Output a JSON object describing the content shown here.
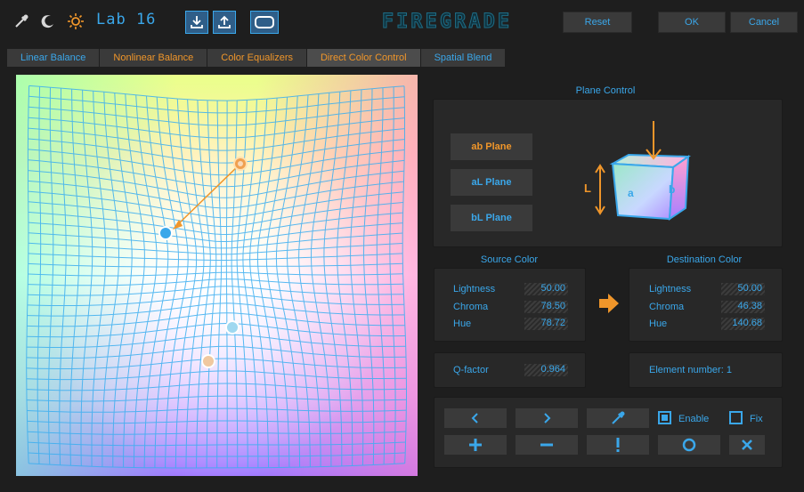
{
  "toolbar": {
    "icons": [
      "eyedropper-icon",
      "moon-icon",
      "sun-icon",
      "download-icon",
      "upload-icon",
      "display-frame-icon"
    ],
    "mode": "Lab 16",
    "brand": "FIREGRADE",
    "reset_label": "Reset",
    "ok_label": "OK",
    "cancel_label": "Cancel"
  },
  "tabs": [
    {
      "label": "Linear Balance",
      "color": "#3aa7ea",
      "active": false
    },
    {
      "label": "Nonlinear Balance",
      "color": "#f0962a",
      "active": false
    },
    {
      "label": "Color Equalizers",
      "color": "#f0962a",
      "active": false
    },
    {
      "label": "Direct Color Control",
      "color": "#f0962a",
      "active": true
    },
    {
      "label": "Spatial Blend",
      "color": "#3aa7ea",
      "active": false
    }
  ],
  "plane_control": {
    "title": "Plane Control",
    "buttons": [
      {
        "label": "ab Plane",
        "active": true
      },
      {
        "label": "aL Plane",
        "active": false
      },
      {
        "label": "bL Plane",
        "active": false
      }
    ],
    "cube_labels": {
      "L": "L",
      "a": "a",
      "b": "b"
    }
  },
  "source": {
    "title": "Source Color",
    "rows": [
      {
        "label": "Lightness",
        "value": "50.00"
      },
      {
        "label": "Chroma",
        "value": "78.50"
      },
      {
        "label": "Hue",
        "value": "78.72"
      }
    ]
  },
  "destination": {
    "title": "Destination Color",
    "rows": [
      {
        "label": "Lightness",
        "value": "50.00"
      },
      {
        "label": "Chroma",
        "value": "46.38"
      },
      {
        "label": "Hue",
        "value": "140.68"
      }
    ]
  },
  "qfactor": {
    "label": "Q-factor",
    "value": "0.964"
  },
  "element": {
    "label": "Element number: 1"
  },
  "actions": {
    "enable_label": "Enable",
    "enable_checked": true,
    "fix_label": "Fix",
    "fix_checked": false,
    "buttons": [
      "chevron-left-icon",
      "chevron-right-icon",
      "eyedropper-icon",
      "plus-icon",
      "minus-icon",
      "exclamation-icon",
      "circle-icon",
      "close-icon"
    ]
  },
  "colors": {
    "accent_blue": "#3aa7ea",
    "accent_orange": "#f0962a",
    "background": "#1e1e1e",
    "panel": "#282828",
    "button": "#3a3a3a"
  }
}
